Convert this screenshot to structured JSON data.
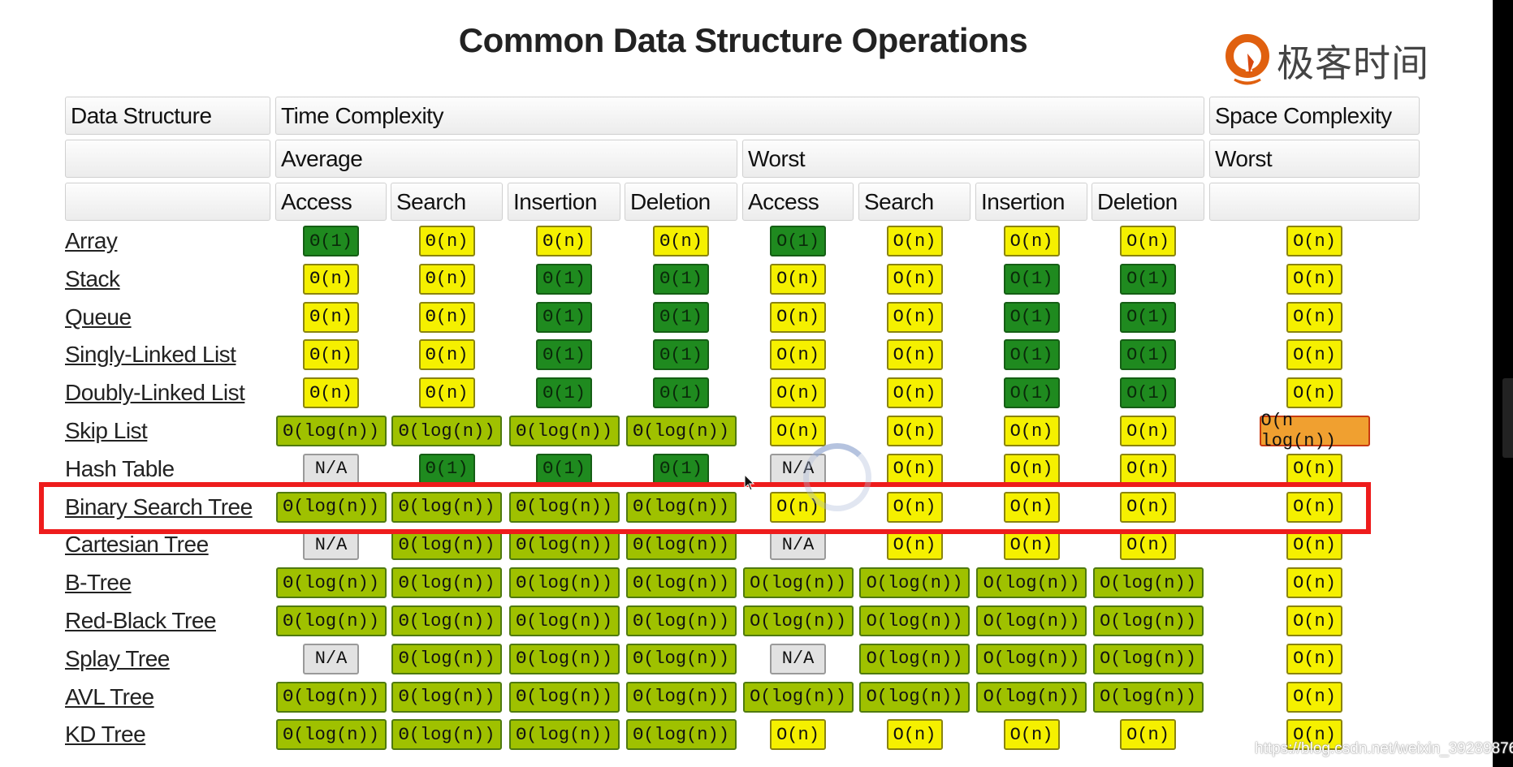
{
  "title": "Common Data Structure Operations",
  "logo": {
    "text": "极客时间",
    "color": "#e0600f"
  },
  "header": {
    "data_structure": "Data Structure",
    "time_complexity": "Time Complexity",
    "space_complexity": "Space Complexity",
    "average": "Average",
    "worst": "Worst",
    "space_worst": "Worst",
    "columns": [
      "Access",
      "Search",
      "Insertion",
      "Deletion",
      "Access",
      "Search",
      "Insertion",
      "Deletion"
    ]
  },
  "colors": {
    "good": "#1f8a1f",
    "fair": "#9fc100",
    "bad": "#f5f000",
    "horrible": "#f0a030",
    "na": "#e2e2e2",
    "highlight": "#ee1c1c"
  },
  "rows": [
    {
      "name": "Array",
      "link": true,
      "cells": [
        [
          "Θ(1)",
          "good"
        ],
        [
          "Θ(n)",
          "bad"
        ],
        [
          "Θ(n)",
          "bad"
        ],
        [
          "Θ(n)",
          "bad"
        ],
        [
          "O(1)",
          "good"
        ],
        [
          "O(n)",
          "bad"
        ],
        [
          "O(n)",
          "bad"
        ],
        [
          "O(n)",
          "bad"
        ],
        [
          "O(n)",
          "bad"
        ]
      ]
    },
    {
      "name": "Stack",
      "link": true,
      "cells": [
        [
          "Θ(n)",
          "bad"
        ],
        [
          "Θ(n)",
          "bad"
        ],
        [
          "Θ(1)",
          "good"
        ],
        [
          "Θ(1)",
          "good"
        ],
        [
          "O(n)",
          "bad"
        ],
        [
          "O(n)",
          "bad"
        ],
        [
          "O(1)",
          "good"
        ],
        [
          "O(1)",
          "good"
        ],
        [
          "O(n)",
          "bad"
        ]
      ]
    },
    {
      "name": "Queue",
      "link": true,
      "cells": [
        [
          "Θ(n)",
          "bad"
        ],
        [
          "Θ(n)",
          "bad"
        ],
        [
          "Θ(1)",
          "good"
        ],
        [
          "Θ(1)",
          "good"
        ],
        [
          "O(n)",
          "bad"
        ],
        [
          "O(n)",
          "bad"
        ],
        [
          "O(1)",
          "good"
        ],
        [
          "O(1)",
          "good"
        ],
        [
          "O(n)",
          "bad"
        ]
      ]
    },
    {
      "name": "Singly-Linked List",
      "link": true,
      "cells": [
        [
          "Θ(n)",
          "bad"
        ],
        [
          "Θ(n)",
          "bad"
        ],
        [
          "Θ(1)",
          "good"
        ],
        [
          "Θ(1)",
          "good"
        ],
        [
          "O(n)",
          "bad"
        ],
        [
          "O(n)",
          "bad"
        ],
        [
          "O(1)",
          "good"
        ],
        [
          "O(1)",
          "good"
        ],
        [
          "O(n)",
          "bad"
        ]
      ]
    },
    {
      "name": "Doubly-Linked List",
      "link": true,
      "cells": [
        [
          "Θ(n)",
          "bad"
        ],
        [
          "Θ(n)",
          "bad"
        ],
        [
          "Θ(1)",
          "good"
        ],
        [
          "Θ(1)",
          "good"
        ],
        [
          "O(n)",
          "bad"
        ],
        [
          "O(n)",
          "bad"
        ],
        [
          "O(1)",
          "good"
        ],
        [
          "O(1)",
          "good"
        ],
        [
          "O(n)",
          "bad"
        ]
      ]
    },
    {
      "name": "Skip List",
      "link": true,
      "cells": [
        [
          "Θ(log(n))",
          "fair"
        ],
        [
          "Θ(log(n))",
          "fair"
        ],
        [
          "Θ(log(n))",
          "fair"
        ],
        [
          "Θ(log(n))",
          "fair"
        ],
        [
          "O(n)",
          "bad"
        ],
        [
          "O(n)",
          "bad"
        ],
        [
          "O(n)",
          "bad"
        ],
        [
          "O(n)",
          "bad"
        ],
        [
          "O(n log(n))",
          "horrible"
        ]
      ]
    },
    {
      "name": "Hash Table",
      "link": false,
      "cells": [
        [
          "N/A",
          "na"
        ],
        [
          "Θ(1)",
          "good"
        ],
        [
          "Θ(1)",
          "good"
        ],
        [
          "Θ(1)",
          "good"
        ],
        [
          "N/A",
          "na"
        ],
        [
          "O(n)",
          "bad"
        ],
        [
          "O(n)",
          "bad"
        ],
        [
          "O(n)",
          "bad"
        ],
        [
          "O(n)",
          "bad"
        ]
      ]
    },
    {
      "name": "Binary Search Tree",
      "link": true,
      "highlighted": true,
      "cells": [
        [
          "Θ(log(n))",
          "fair"
        ],
        [
          "Θ(log(n))",
          "fair"
        ],
        [
          "Θ(log(n))",
          "fair"
        ],
        [
          "Θ(log(n))",
          "fair"
        ],
        [
          "O(n)",
          "bad"
        ],
        [
          "O(n)",
          "bad"
        ],
        [
          "O(n)",
          "bad"
        ],
        [
          "O(n)",
          "bad"
        ],
        [
          "O(n)",
          "bad"
        ]
      ]
    },
    {
      "name": "Cartesian Tree",
      "link": true,
      "cells": [
        [
          "N/A",
          "na"
        ],
        [
          "Θ(log(n))",
          "fair"
        ],
        [
          "Θ(log(n))",
          "fair"
        ],
        [
          "Θ(log(n))",
          "fair"
        ],
        [
          "N/A",
          "na"
        ],
        [
          "O(n)",
          "bad"
        ],
        [
          "O(n)",
          "bad"
        ],
        [
          "O(n)",
          "bad"
        ],
        [
          "O(n)",
          "bad"
        ]
      ]
    },
    {
      "name": "B-Tree",
      "link": true,
      "cells": [
        [
          "Θ(log(n))",
          "fair"
        ],
        [
          "Θ(log(n))",
          "fair"
        ],
        [
          "Θ(log(n))",
          "fair"
        ],
        [
          "Θ(log(n))",
          "fair"
        ],
        [
          "O(log(n))",
          "fair"
        ],
        [
          "O(log(n))",
          "fair"
        ],
        [
          "O(log(n))",
          "fair"
        ],
        [
          "O(log(n))",
          "fair"
        ],
        [
          "O(n)",
          "bad"
        ]
      ]
    },
    {
      "name": "Red-Black Tree",
      "link": true,
      "cells": [
        [
          "Θ(log(n))",
          "fair"
        ],
        [
          "Θ(log(n))",
          "fair"
        ],
        [
          "Θ(log(n))",
          "fair"
        ],
        [
          "Θ(log(n))",
          "fair"
        ],
        [
          "O(log(n))",
          "fair"
        ],
        [
          "O(log(n))",
          "fair"
        ],
        [
          "O(log(n))",
          "fair"
        ],
        [
          "O(log(n))",
          "fair"
        ],
        [
          "O(n)",
          "bad"
        ]
      ]
    },
    {
      "name": "Splay Tree",
      "link": true,
      "cells": [
        [
          "N/A",
          "na"
        ],
        [
          "Θ(log(n))",
          "fair"
        ],
        [
          "Θ(log(n))",
          "fair"
        ],
        [
          "Θ(log(n))",
          "fair"
        ],
        [
          "N/A",
          "na"
        ],
        [
          "O(log(n))",
          "fair"
        ],
        [
          "O(log(n))",
          "fair"
        ],
        [
          "O(log(n))",
          "fair"
        ],
        [
          "O(n)",
          "bad"
        ]
      ]
    },
    {
      "name": "AVL Tree",
      "link": true,
      "cells": [
        [
          "Θ(log(n))",
          "fair"
        ],
        [
          "Θ(log(n))",
          "fair"
        ],
        [
          "Θ(log(n))",
          "fair"
        ],
        [
          "Θ(log(n))",
          "fair"
        ],
        [
          "O(log(n))",
          "fair"
        ],
        [
          "O(log(n))",
          "fair"
        ],
        [
          "O(log(n))",
          "fair"
        ],
        [
          "O(log(n))",
          "fair"
        ],
        [
          "O(n)",
          "bad"
        ]
      ]
    },
    {
      "name": "KD Tree",
      "link": true,
      "cells": [
        [
          "Θ(log(n))",
          "fair"
        ],
        [
          "Θ(log(n))",
          "fair"
        ],
        [
          "Θ(log(n))",
          "fair"
        ],
        [
          "Θ(log(n))",
          "fair"
        ],
        [
          "O(n)",
          "bad"
        ],
        [
          "O(n)",
          "bad"
        ],
        [
          "O(n)",
          "bad"
        ],
        [
          "O(n)",
          "bad"
        ],
        [
          "O(n)",
          "bad"
        ]
      ]
    }
  ],
  "watermark": "https://blog.csdn.net/weixin_39289876"
}
